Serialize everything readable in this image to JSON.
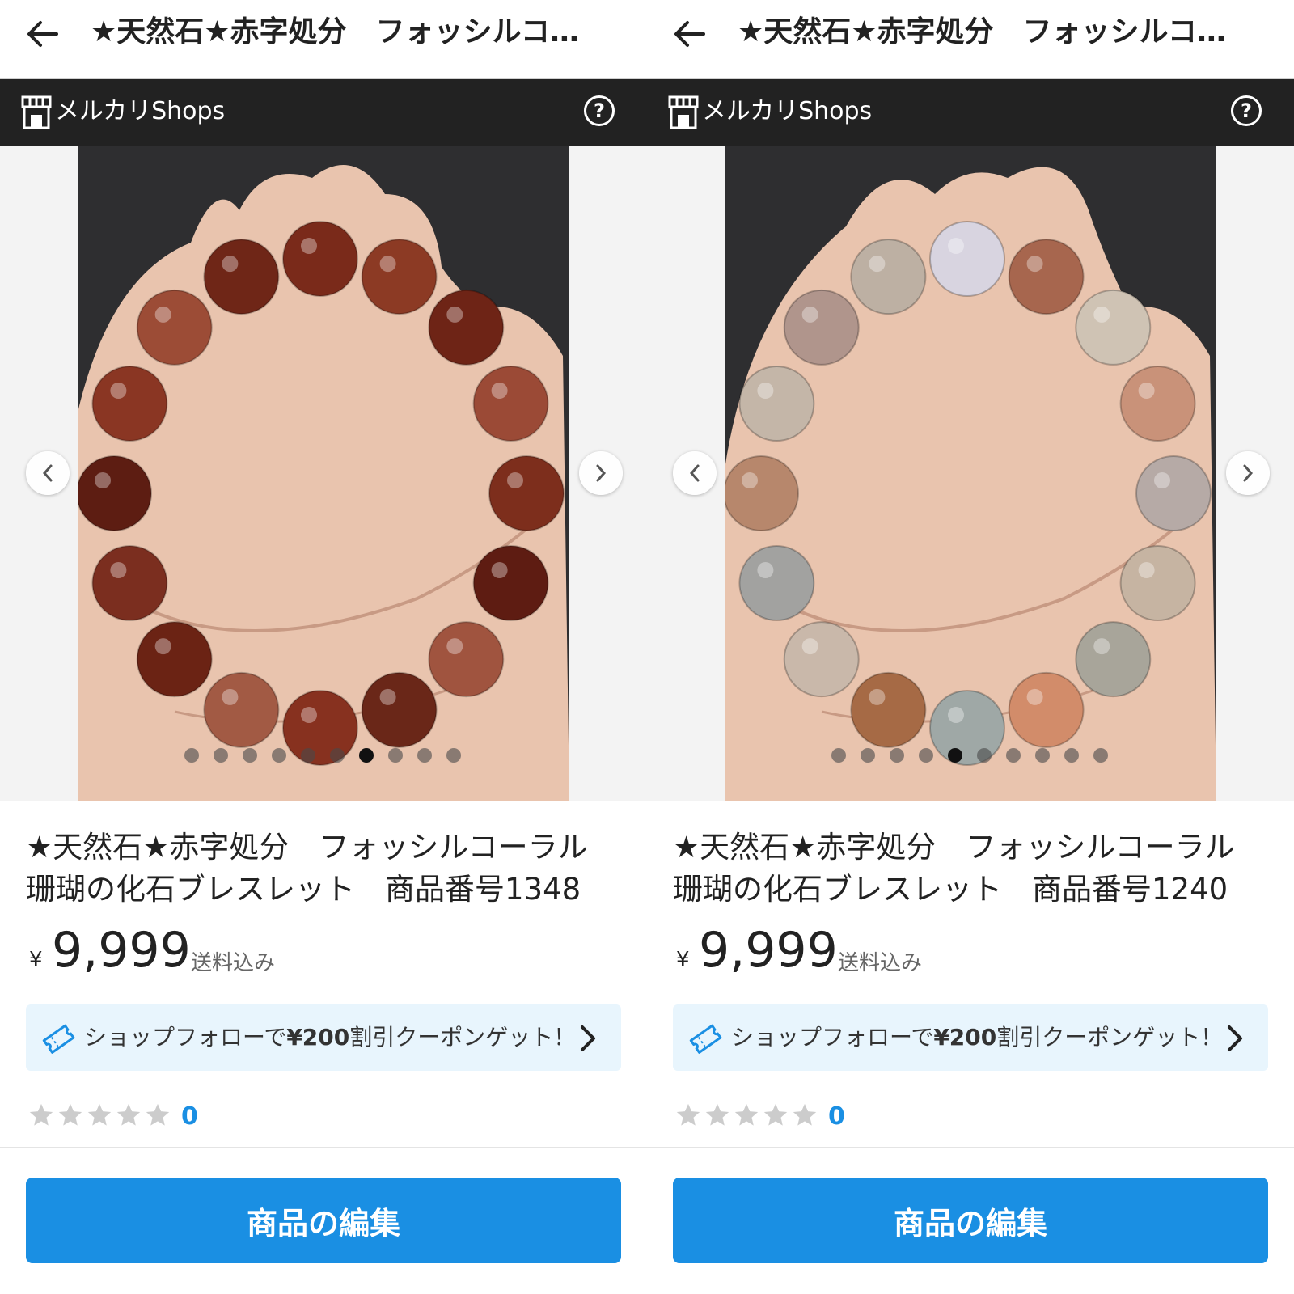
{
  "colors": {
    "accent": "#1a8fe3",
    "shops_bar": "#222222",
    "coupon_bg": "#e8f5fd"
  },
  "panels": [
    {
      "header_title": "★天然石★赤字処分　フォッシルコ…",
      "shops_label": "メルカリShops",
      "help_label": "?",
      "gallery": {
        "image_count": 10,
        "active_index": 6,
        "image_desc": "hand holding dark red/brown fossil coral bead bracelet"
      },
      "title_line1": "★天然石★赤字処分　フォッシルコーラル",
      "title_line2": "珊瑚の化石ブレスレット　商品番号1348",
      "currency": "¥",
      "price": "9,999",
      "shipping": "送料込み",
      "coupon_text_pre": "ショップフォローで",
      "coupon_amount": "¥200",
      "coupon_text_post": "割引クーポンゲット！",
      "rating_stars": 0,
      "rating_count": "0",
      "edit_button": "商品の編集"
    },
    {
      "header_title": "★天然石★赤字処分　フォッシルコ…",
      "shops_label": "メルカリShops",
      "help_label": "?",
      "gallery": {
        "image_count": 10,
        "active_index": 4,
        "image_desc": "hand holding multicolor fossil coral bead bracelet"
      },
      "title_line1": "★天然石★赤字処分　フォッシルコーラル",
      "title_line2": "珊瑚の化石ブレスレット　商品番号1240",
      "currency": "¥",
      "price": "9,999",
      "shipping": "送料込み",
      "coupon_text_pre": "ショップフォローで",
      "coupon_amount": "¥200",
      "coupon_text_post": "割引クーポンゲット！",
      "rating_stars": 0,
      "rating_count": "0",
      "edit_button": "商品の編集"
    }
  ]
}
